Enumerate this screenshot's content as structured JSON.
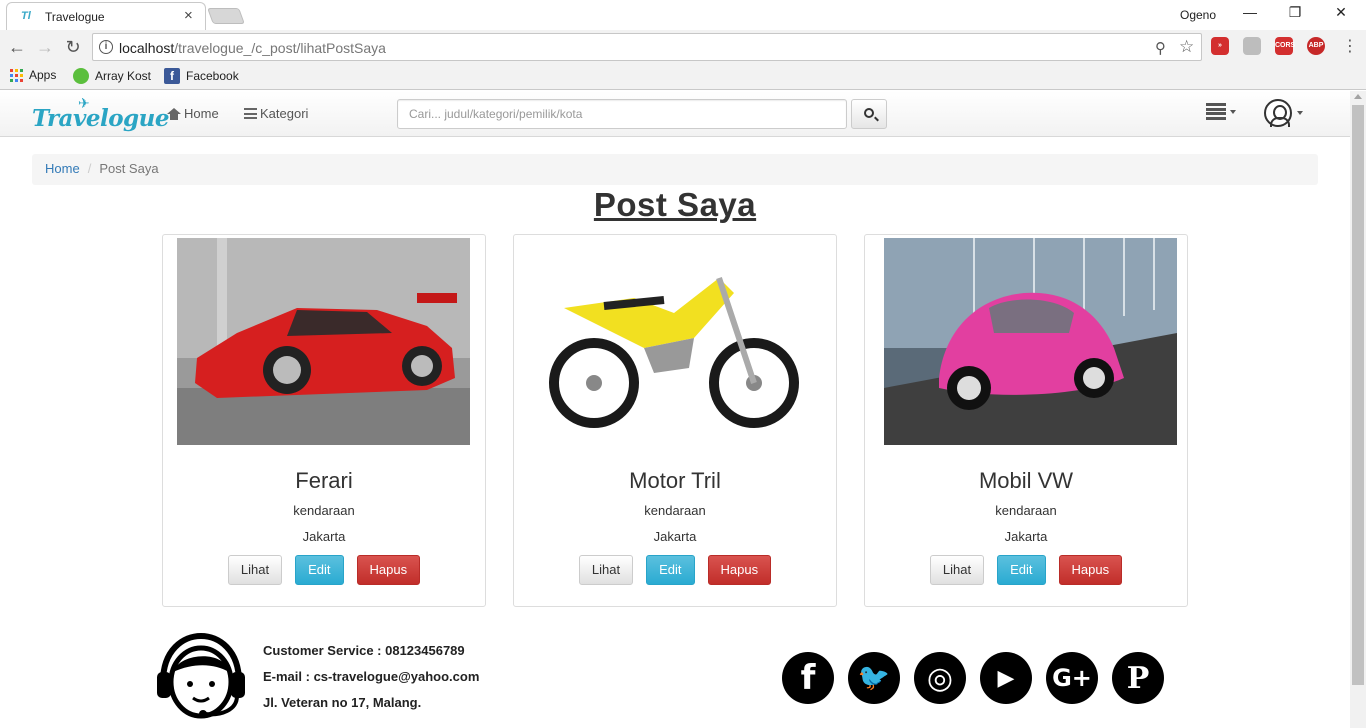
{
  "browser": {
    "tab_title": "Travelogue",
    "tab_favicon": "Tl",
    "tab_close": "×",
    "profile_name": "Ogeno",
    "url_host": "localhost",
    "url_path": "/travelogue_/c_post/lihatPostSaya",
    "bookmarks": [
      "Apps",
      "Array Kost",
      "Facebook"
    ],
    "window_controls": [
      "—",
      "❐",
      "✕"
    ]
  },
  "navbar": {
    "brand": "Travelogue",
    "home_label": "Home",
    "kategori_label": "Kategori",
    "search_placeholder": "Cari... judul/kategori/pemilik/kota"
  },
  "breadcrumb": {
    "home": "Home",
    "separator": "/",
    "current": "Post Saya"
  },
  "page_title": "Post Saya",
  "posts": [
    {
      "title": "Ferari",
      "category": "kendaraan",
      "city": "Jakarta",
      "image": "red-sports-car"
    },
    {
      "title": "Motor Tril",
      "category": "kendaraan",
      "city": "Jakarta",
      "image": "yellow-dirt-bike"
    },
    {
      "title": "Mobil VW",
      "category": "kendaraan",
      "city": "Jakarta",
      "image": "pink-vw-beetle"
    }
  ],
  "buttons": {
    "view": "Lihat",
    "edit": "Edit",
    "delete": "Hapus"
  },
  "footer": {
    "customer_service": "Customer Service : 08123456789",
    "email": "E-mail : cs-travelogue@yahoo.com",
    "address": "Jl. Veteran no 17, Malang."
  },
  "socials": [
    {
      "name": "facebook",
      "glyph": "f"
    },
    {
      "name": "twitter",
      "glyph": "🐦"
    },
    {
      "name": "instagram",
      "glyph": "◎"
    },
    {
      "name": "youtube",
      "glyph": "▶"
    },
    {
      "name": "google-plus",
      "glyph": "G+"
    },
    {
      "name": "pinterest",
      "glyph": "P"
    }
  ],
  "colors": {
    "brand": "#2ba5c4",
    "link": "#337ab7",
    "info": "#5bc0de",
    "danger": "#d9534f"
  }
}
